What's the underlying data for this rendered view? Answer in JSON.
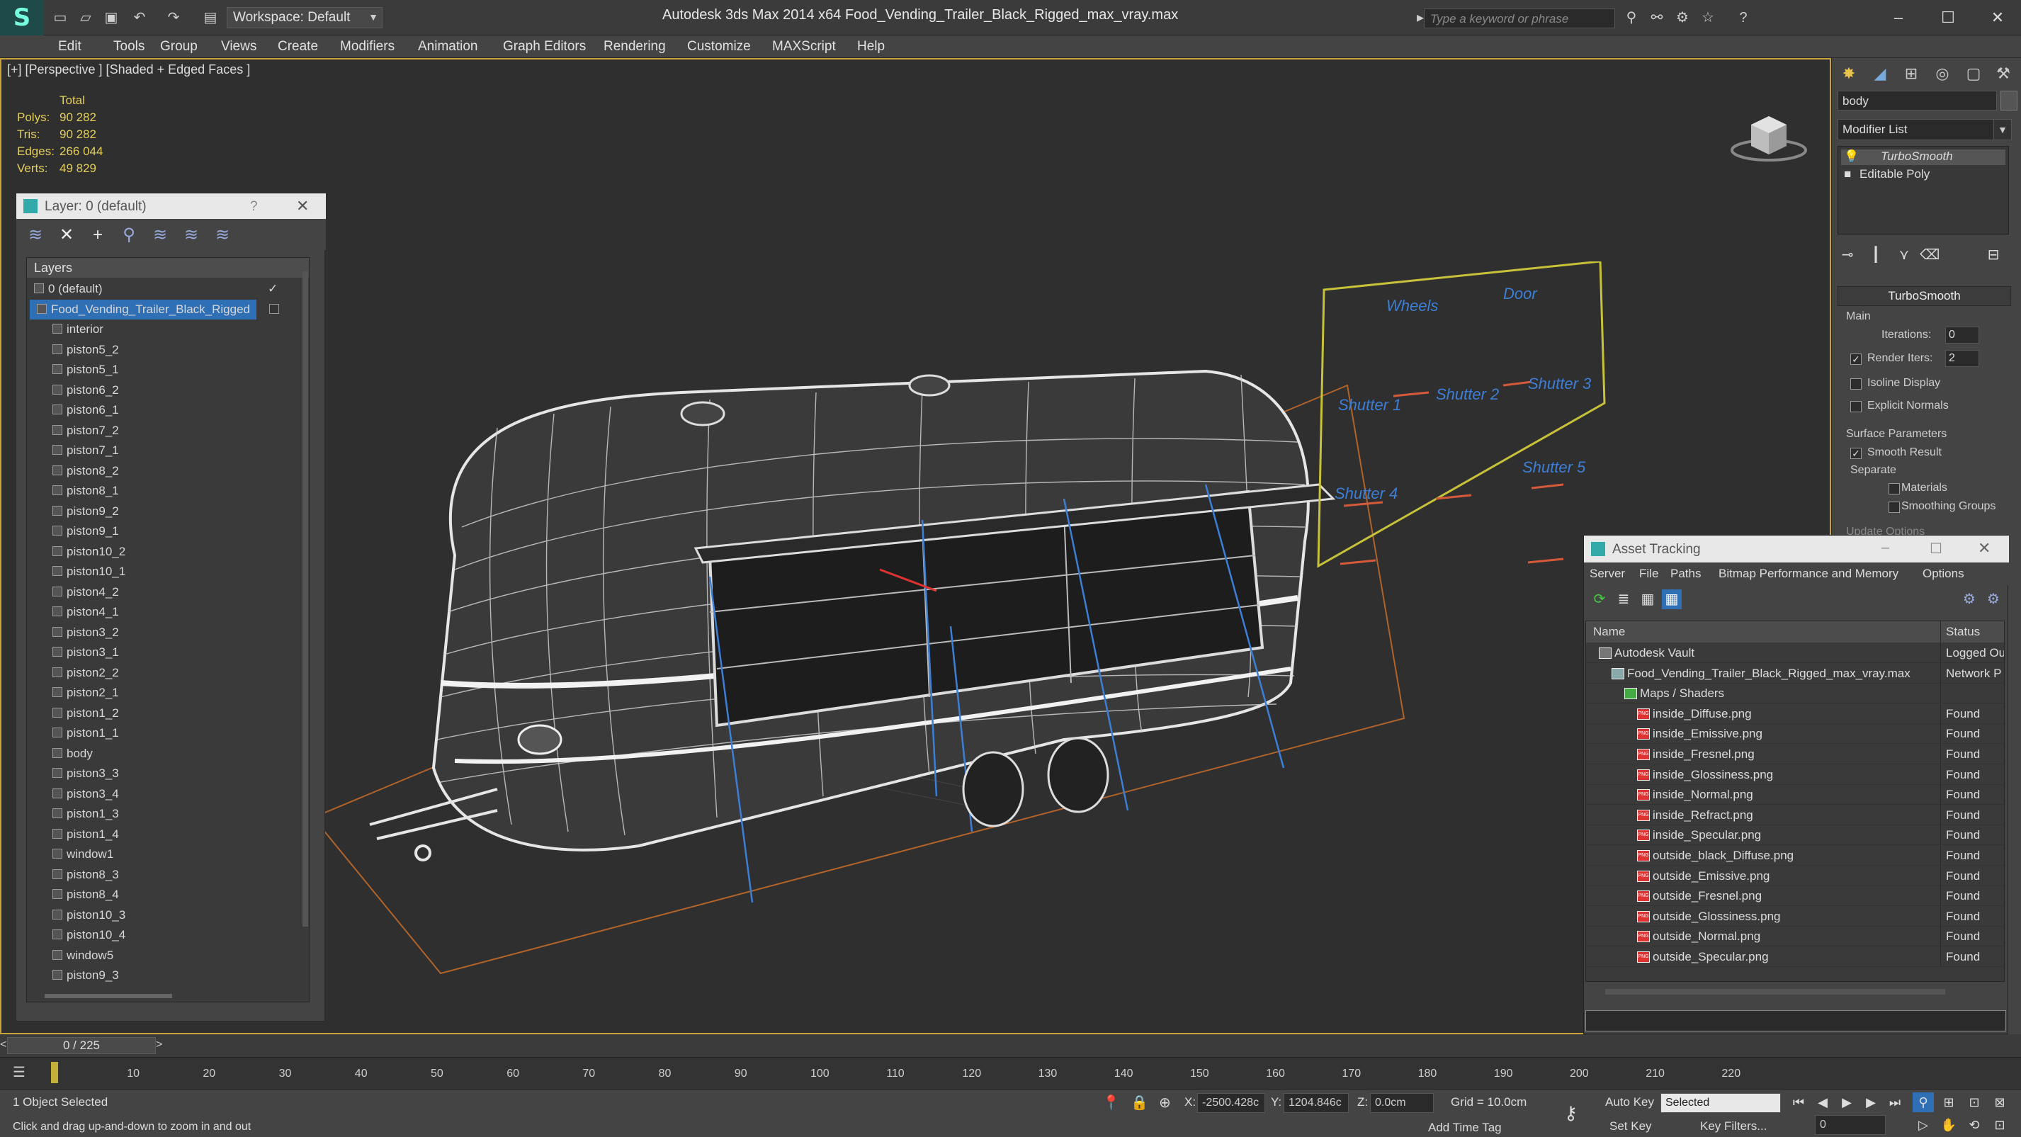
{
  "titlebar": {
    "workspace": "Workspace: Default",
    "app_title": "Autodesk 3ds Max  2014 x64        Food_Vending_Trailer_Black_Rigged_max_vray.max",
    "search_placeholder": "Type a keyword or phrase"
  },
  "menu": [
    "Edit",
    "Tools",
    "Group",
    "Views",
    "Create",
    "Modifiers",
    "Animation",
    "Graph Editors",
    "Rendering",
    "Customize",
    "MAXScript",
    "Help"
  ],
  "viewport": {
    "label": "[+] [Perspective ] [Shaded + Edged Faces ]",
    "stats": {
      "total_label": "Total",
      "rows": [
        {
          "label": "Polys:",
          "value": "90 282"
        },
        {
          "label": "Tris:",
          "value": "90 282"
        },
        {
          "label": "Edges:",
          "value": "266 044"
        },
        {
          "label": "Verts:",
          "value": "49 829"
        }
      ]
    },
    "rig_labels": [
      "Wheels",
      "Door",
      "Shutter 1",
      "Shutter 2",
      "Shutter 3",
      "Shutter 4",
      "Shutter 5"
    ]
  },
  "layer_panel": {
    "title": "Layer: 0 (default)",
    "help": "?",
    "header": "Layers",
    "layers": [
      "0 (default)",
      "Food_Vending_Trailer_Black_Rigged",
      "interior",
      "piston5_2",
      "piston5_1",
      "piston6_2",
      "piston6_1",
      "piston7_2",
      "piston7_1",
      "piston8_2",
      "piston8_1",
      "piston9_2",
      "piston9_1",
      "piston10_2",
      "piston10_1",
      "piston4_2",
      "piston4_1",
      "piston3_2",
      "piston3_1",
      "piston2_2",
      "piston2_1",
      "piston1_2",
      "piston1_1",
      "body",
      "piston3_3",
      "piston3_4",
      "piston1_3",
      "piston1_4",
      "window1",
      "piston8_3",
      "piston8_4",
      "piston10_3",
      "piston10_4",
      "window5",
      "piston9_3"
    ]
  },
  "command_panel": {
    "object_name": "body",
    "modifier_list": "Modifier List",
    "stack": [
      "TurboSmooth",
      "Editable Poly"
    ],
    "rollout_title": "TurboSmooth",
    "main_label": "Main",
    "iterations_label": "Iterations:",
    "iterations_value": "0",
    "render_iters_label": "Render Iters:",
    "render_iters_value": "2",
    "isoline": "Isoline Display",
    "explicit_normals": "Explicit Normals",
    "surface_params": "Surface Parameters",
    "smooth_result": "Smooth Result",
    "separate": "Separate",
    "materials": "Materials",
    "smoothing_groups": "Smoothing Groups",
    "update_options": "Update Options"
  },
  "asset_tracking": {
    "title": "Asset Tracking",
    "menu": [
      "Server",
      "File",
      "Paths",
      "Bitmap Performance and Memory",
      "Options"
    ],
    "col_name": "Name",
    "col_status": "Status",
    "rows": [
      {
        "name": "Autodesk Vault",
        "status": "Logged Ou",
        "indent": 0
      },
      {
        "name": "Food_Vending_Trailer_Black_Rigged_max_vray.max",
        "status": "Network P",
        "indent": 1
      },
      {
        "name": "Maps / Shaders",
        "status": "",
        "indent": 2
      },
      {
        "name": "inside_Diffuse.png",
        "status": "Found",
        "indent": 3
      },
      {
        "name": "inside_Emissive.png",
        "status": "Found",
        "indent": 3
      },
      {
        "name": "inside_Fresnel.png",
        "status": "Found",
        "indent": 3
      },
      {
        "name": "inside_Glossiness.png",
        "status": "Found",
        "indent": 3
      },
      {
        "name": "inside_Normal.png",
        "status": "Found",
        "indent": 3
      },
      {
        "name": "inside_Refract.png",
        "status": "Found",
        "indent": 3
      },
      {
        "name": "inside_Specular.png",
        "status": "Found",
        "indent": 3
      },
      {
        "name": "outside_black_Diffuse.png",
        "status": "Found",
        "indent": 3
      },
      {
        "name": "outside_Emissive.png",
        "status": "Found",
        "indent": 3
      },
      {
        "name": "outside_Fresnel.png",
        "status": "Found",
        "indent": 3
      },
      {
        "name": "outside_Glossiness.png",
        "status": "Found",
        "indent": 3
      },
      {
        "name": "outside_Normal.png",
        "status": "Found",
        "indent": 3
      },
      {
        "name": "outside_Specular.png",
        "status": "Found",
        "indent": 3
      }
    ]
  },
  "timeline": {
    "frame": "0 / 225",
    "ticks": [
      "10",
      "20",
      "30",
      "40",
      "50",
      "60",
      "70",
      "80",
      "90",
      "100",
      "110",
      "120",
      "130",
      "140",
      "150",
      "160",
      "170",
      "180",
      "190",
      "200",
      "210",
      "220"
    ]
  },
  "status": {
    "selected": "1 Object Selected",
    "prompt": "Click and drag up-and-down to zoom in and out",
    "x_label": "X:",
    "x_value": "-2500.428c",
    "y_label": "Y:",
    "y_value": "1204.846c",
    "z_label": "Z:",
    "z_value": "0.0cm",
    "grid": "Grid = 10.0cm",
    "auto_key": "Auto Key",
    "set_key": "Set Key",
    "selected_filter": "Selected",
    "key_filters": "Key Filters...",
    "add_time_tag": "Add Time Tag",
    "frame_value": "0"
  }
}
